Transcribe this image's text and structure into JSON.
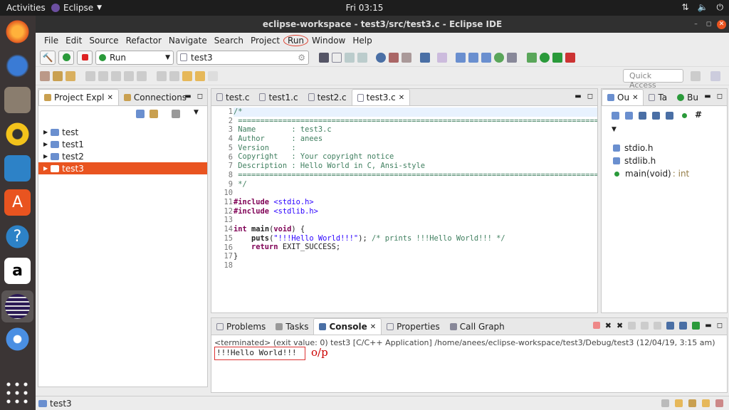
{
  "topbar": {
    "activities": "Activities",
    "app": "Eclipse",
    "clock": "Fri 03:15"
  },
  "window": {
    "title": "eclipse-workspace - test3/src/test3.c - Eclipse IDE"
  },
  "menu": [
    "File",
    "Edit",
    "Source",
    "Refactor",
    "Navigate",
    "Search",
    "Project",
    "Run",
    "Window",
    "Help"
  ],
  "toolbar": {
    "run_combo": "Run",
    "project_combo": "test3",
    "quick_access": "Quick Access"
  },
  "left_panel": {
    "tab1": "Project Expl",
    "tab2": "Connections",
    "projects": [
      "test",
      "test1",
      "test2",
      "test3"
    ],
    "selected": "test3"
  },
  "editor": {
    "tabs": [
      "test.c",
      "test1.c",
      "test2.c",
      "test3.c"
    ],
    "active_tab": "test3.c",
    "line_numbers": [
      "1",
      "2",
      "3",
      "4",
      "5",
      "6",
      "7",
      "8",
      "9",
      "10",
      "11",
      "12",
      "13",
      "14",
      "15",
      "16",
      "17",
      "18"
    ]
  },
  "outline": {
    "tab1": "Ou",
    "tab2": "Ta",
    "tab3": "Bu",
    "items": [
      "stdio.h",
      "stdlib.h",
      "main(void)"
    ],
    "main_return": ": int"
  },
  "bottom": {
    "tabs": [
      "Problems",
      "Tasks",
      "Console",
      "Properties",
      "Call Graph"
    ],
    "active": "Console",
    "terminated": "<terminated> (exit value: 0) test3 [C/C++ Application] /home/anees/eclipse-workspace/test3/Debug/test3 (12/04/19, 3:15 am)",
    "output": "!!!Hello World!!!",
    "annotation": "o/p"
  },
  "status": {
    "text": "test3"
  },
  "colors": {
    "accent": "#e95420",
    "comment": "#3f7f5f",
    "keyword": "#7f0055",
    "string": "#2a00ff"
  }
}
